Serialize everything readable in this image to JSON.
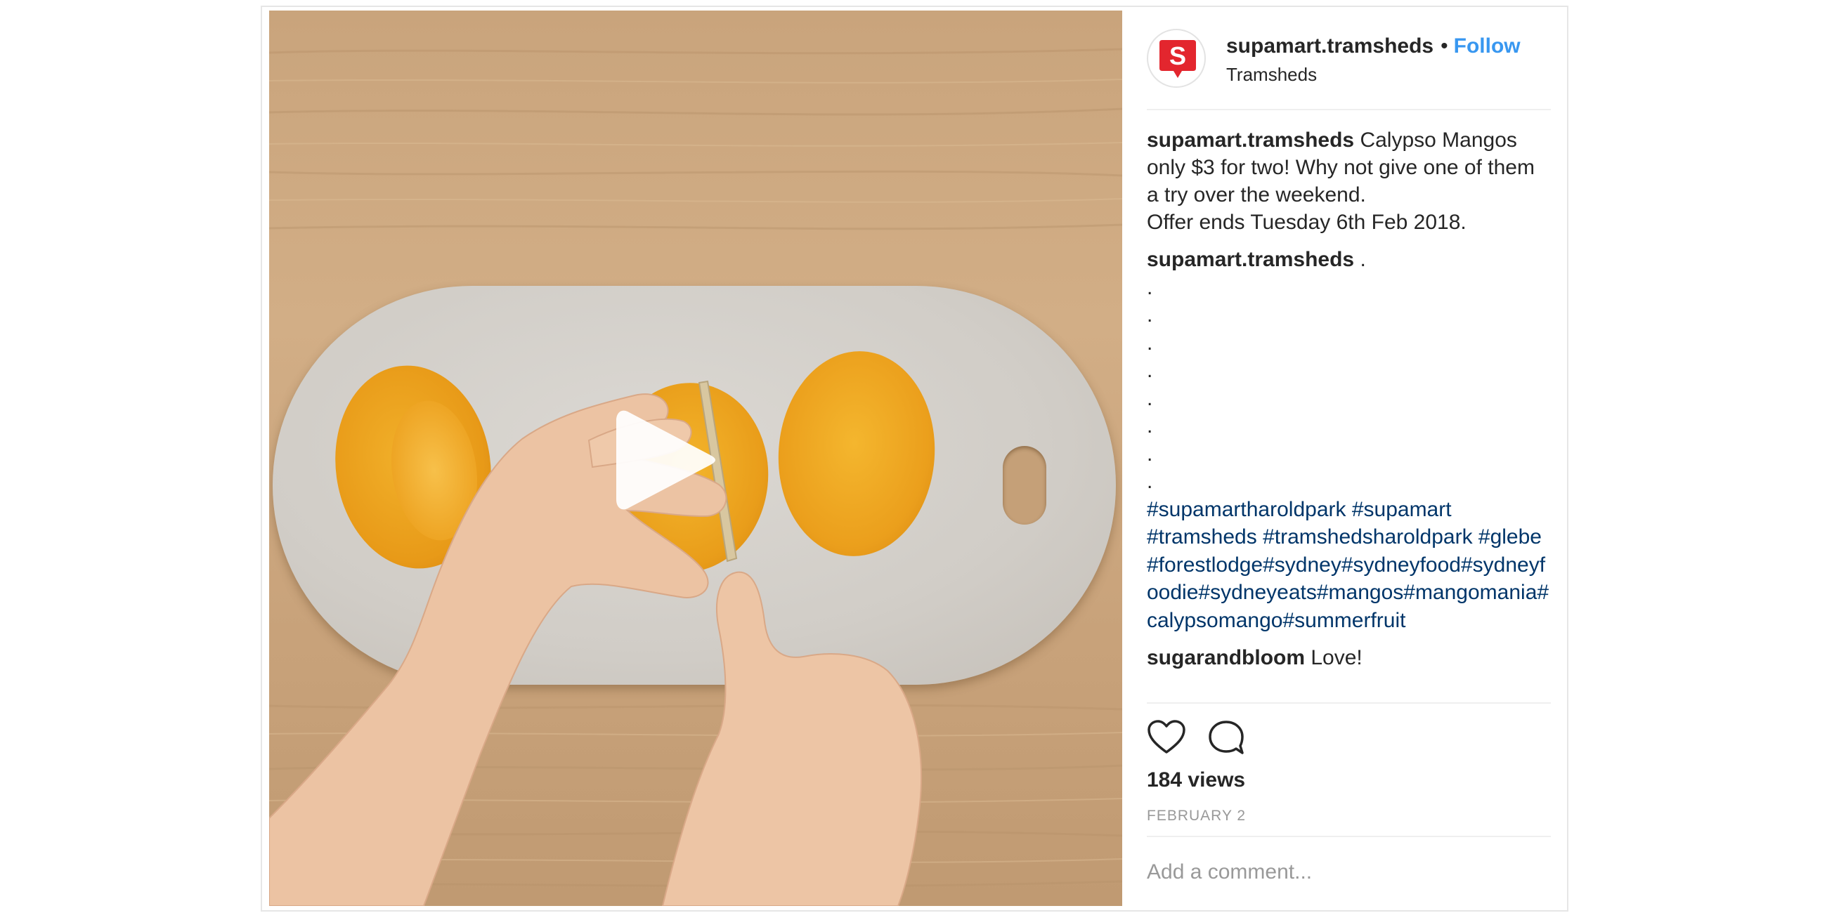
{
  "post": {
    "username": "supamart.tramsheds",
    "separator": "•",
    "follow_label": "Follow",
    "location": "Tramsheds",
    "avatar_letter": "S",
    "brand_color": "#e3262e",
    "link_color": "#3897f0",
    "hashtag_color": "#003569"
  },
  "caption": {
    "username": "supamart.tramsheds",
    "line1_text": "Calypso Mangos",
    "line2": "only $3 for two! Why not give one of them",
    "line3": "a try over the weekend.",
    "line4": "Offer ends Tuesday 6th Feb 2018."
  },
  "comments": [
    {
      "username": "supamart.tramsheds",
      "text": ".",
      "dots": [
        ".",
        ".",
        ".",
        ".",
        ".",
        ".",
        ".",
        "."
      ],
      "hashtag_lines": [
        "#supamartharoldpark #supamart",
        "#tramsheds #tramshedsharoldpark #glebe",
        "#forestlodge#sydney#sydneyfood#sydneyf",
        "oodie#sydneyeats#mangos#mangomania#",
        "calypsomango#summerfruit"
      ]
    },
    {
      "username": "sugarandbloom",
      "text": "Love!"
    }
  ],
  "stats": {
    "views": "184 views",
    "date": "FEBRUARY 2"
  },
  "add_comment": {
    "placeholder": "Add a comment..."
  },
  "icons": [
    "play-icon",
    "heart-icon",
    "comment-icon",
    "avatar-logo"
  ]
}
